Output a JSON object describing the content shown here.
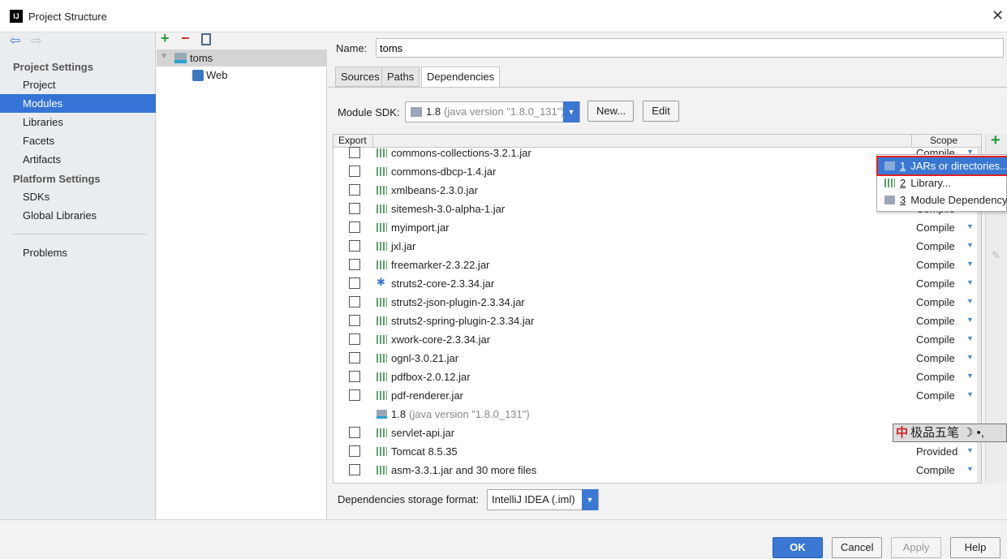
{
  "window": {
    "title": "Project Structure",
    "logo": "IJ"
  },
  "sidebar": {
    "section1": "Project Settings",
    "items1": [
      "Project",
      "Modules",
      "Libraries",
      "Facets",
      "Artifacts"
    ],
    "section2": "Platform Settings",
    "items2": [
      "SDKs",
      "Global Libraries"
    ],
    "problems": "Problems",
    "selected": "Modules"
  },
  "tree": {
    "root": "toms",
    "child": "Web"
  },
  "module": {
    "name_label": "Name:",
    "name_value": "toms",
    "tabs": [
      "Sources",
      "Paths",
      "Dependencies"
    ],
    "active_tab": "Dependencies",
    "sdk_label": "Module SDK:",
    "sdk_value": "1.8",
    "sdk_detail": "(java version \"1.8.0_131\")",
    "new_button": "New...",
    "edit_button": "Edit",
    "header_export": "Export",
    "header_scope": "Scope",
    "rows": [
      {
        "name": "commons-collections-3.2.1.jar",
        "scope": "Compile",
        "check": true
      },
      {
        "name": "commons-dbcp-1.4.jar",
        "scope": "Compile",
        "check": true
      },
      {
        "name": "xmlbeans-2.3.0.jar",
        "scope": "Compile",
        "check": true
      },
      {
        "name": "sitemesh-3.0-alpha-1.jar",
        "scope": "Compile",
        "check": true
      },
      {
        "name": "myimport.jar",
        "scope": "Compile",
        "check": true
      },
      {
        "name": "jxl.jar",
        "scope": "Compile",
        "check": true
      },
      {
        "name": "freemarker-2.3.22.jar",
        "scope": "Compile",
        "check": true
      },
      {
        "name": "struts2-core-2.3.34.jar",
        "scope": "Compile",
        "check": true,
        "icon": "gear"
      },
      {
        "name": "struts2-json-plugin-2.3.34.jar",
        "scope": "Compile",
        "check": true
      },
      {
        "name": "struts2-spring-plugin-2.3.34.jar",
        "scope": "Compile",
        "check": true
      },
      {
        "name": "xwork-core-2.3.34.jar",
        "scope": "Compile",
        "check": true
      },
      {
        "name": "ognl-3.0.21.jar",
        "scope": "Compile",
        "check": true
      },
      {
        "name": "pdfbox-2.0.12.jar",
        "scope": "Compile",
        "check": true
      },
      {
        "name": "pdf-renderer.jar",
        "scope": "Compile",
        "check": true
      },
      {
        "name": "1.8",
        "detail": "(java version \"1.8.0_131\")",
        "check": false,
        "icon": "sdk"
      },
      {
        "name": "servlet-api.jar",
        "scope": "",
        "check": true
      },
      {
        "name": "Tomcat 8.5.35",
        "scope": "Provided",
        "check": true
      },
      {
        "name": "asm-3.3.1.jar and 30 more files",
        "scope": "Compile",
        "check": true
      }
    ],
    "storage_label": "Dependencies storage format:",
    "storage_value": "IntelliJ IDEA (.iml)"
  },
  "popup": {
    "items": [
      {
        "num": "1",
        "label": "JARs or directories..."
      },
      {
        "num": "2",
        "label": "Library..."
      },
      {
        "num": "3",
        "label": "Module Dependency"
      }
    ]
  },
  "ime": {
    "text": "极品五笔"
  },
  "buttons": {
    "ok": "OK",
    "cancel": "Cancel",
    "apply": "Apply",
    "help": "Help"
  },
  "colors": {
    "accent": "#3574d4",
    "popup_highlight": "#e02020"
  }
}
